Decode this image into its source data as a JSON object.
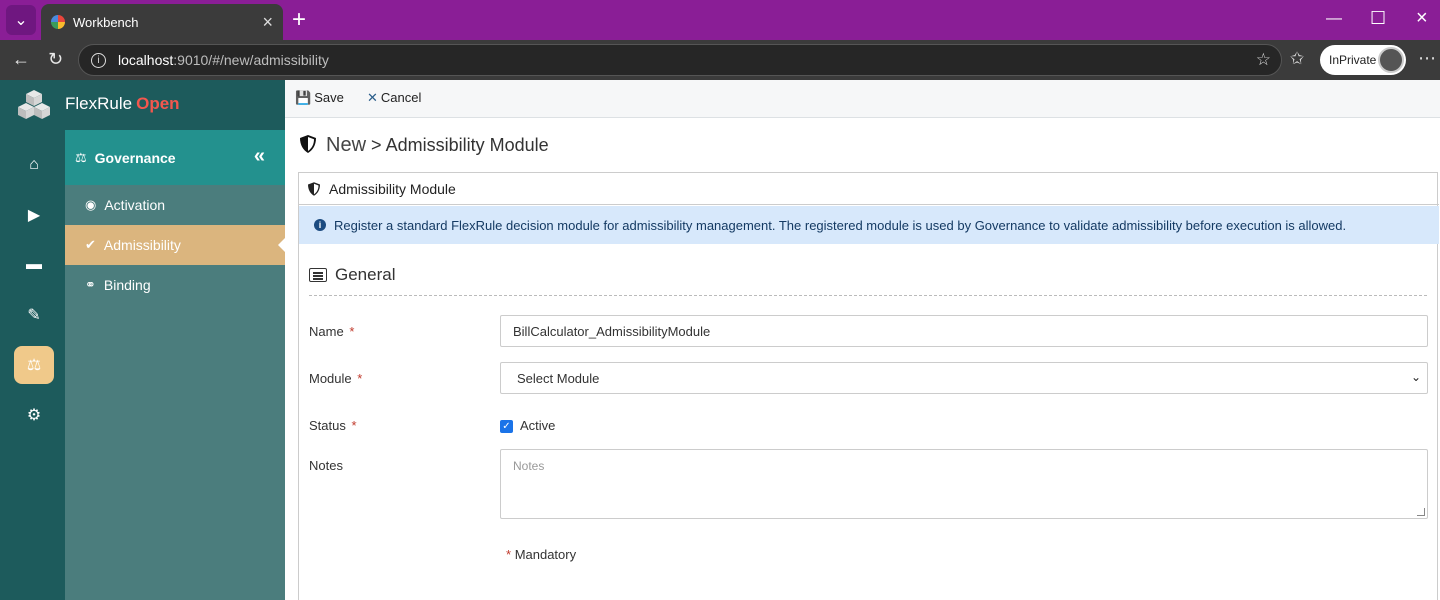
{
  "browser": {
    "tab_title": "Workbench",
    "url_host": "localhost",
    "url_path": ":9010/#/new/admissibility",
    "inprivate_label": "InPrivate"
  },
  "app": {
    "brand_name": "FlexRule",
    "brand_highlight": "Open",
    "rail_icons": [
      "home-icon",
      "play-icon",
      "archive-icon",
      "pencil-icon",
      "scale-icon",
      "gear-icon"
    ],
    "active_rail": "scale-icon"
  },
  "subnav": {
    "header": "Governance",
    "items": [
      {
        "label": "Activation",
        "active": false
      },
      {
        "label": "Admissibility",
        "active": true
      },
      {
        "label": "Binding",
        "active": false
      }
    ]
  },
  "toolbar": {
    "save_label": "Save",
    "cancel_label": "Cancel"
  },
  "page": {
    "title_new": "New",
    "title_separator": ">",
    "title_rest": "Admissibility Module",
    "panel_title": "Admissibility Module",
    "info_text": "Register a standard FlexRule decision module for admissibility management. The registered module is used by Governance to validate admissibility before execution is allowed.",
    "section_title": "General"
  },
  "form": {
    "required_mark": "*",
    "name_label": "Name",
    "name_value": "BillCalculator_AdmissibilityModule",
    "module_label": "Module",
    "module_value": "Select Module",
    "status_label": "Status",
    "status_checkbox_label": "Active",
    "status_checked": true,
    "notes_label": "Notes",
    "notes_placeholder": "Notes",
    "mandatory_note": "Mandatory"
  },
  "colors": {
    "titlebar": "#8a1e96",
    "app_dark": "#1d5b5c",
    "subnav_bg": "#4b7d7d",
    "subnav_header": "#23918e",
    "active_item": "#dbb57e",
    "brand_accent": "#f4574e",
    "info_bg": "#d7e8fb"
  }
}
